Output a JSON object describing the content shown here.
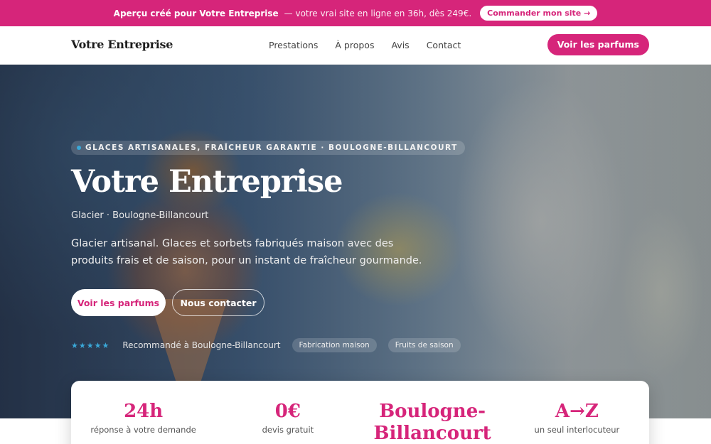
{
  "promo": {
    "strong": "Aperçu créé pour Votre Entreprise",
    "text": "— votre vrai site en ligne en 36h, dès 249€.",
    "cta": "Commander mon site →"
  },
  "header": {
    "brand": "Votre Entreprise",
    "nav": [
      "Prestations",
      "À propos",
      "Avis",
      "Contact"
    ],
    "cta": "Voir les parfums"
  },
  "hero": {
    "eyebrow": "GLACES ARTISANALES, FRAÎCHEUR GARANTIE · BOULOGNE-BILLANCOURT",
    "title": "Votre Entreprise",
    "subtitle": "Glacier · Boulogne-Billancourt",
    "description": "Glacier artisanal. Glaces et sorbets fabriqués maison avec des produits frais et de saison, pour un instant de fraîcheur gourmande.",
    "primary_button": "Voir les parfums",
    "secondary_button": "Nous contacter",
    "rating_stars": "★★★★★",
    "rating_text": "Recommandé à Boulogne-Billancourt",
    "tags": [
      "Fabrication maison",
      "Fruits de saison"
    ]
  },
  "stats": [
    {
      "value": "24h",
      "label": "réponse à votre demande"
    },
    {
      "value": "0€",
      "label": "devis gratuit"
    },
    {
      "value": "Boulogne-Billancourt",
      "label": ""
    },
    {
      "value": "A→Z",
      "label": "un seul interlocuteur"
    }
  ],
  "colors": {
    "accent": "#d6257a",
    "star": "#3aa8d8"
  }
}
